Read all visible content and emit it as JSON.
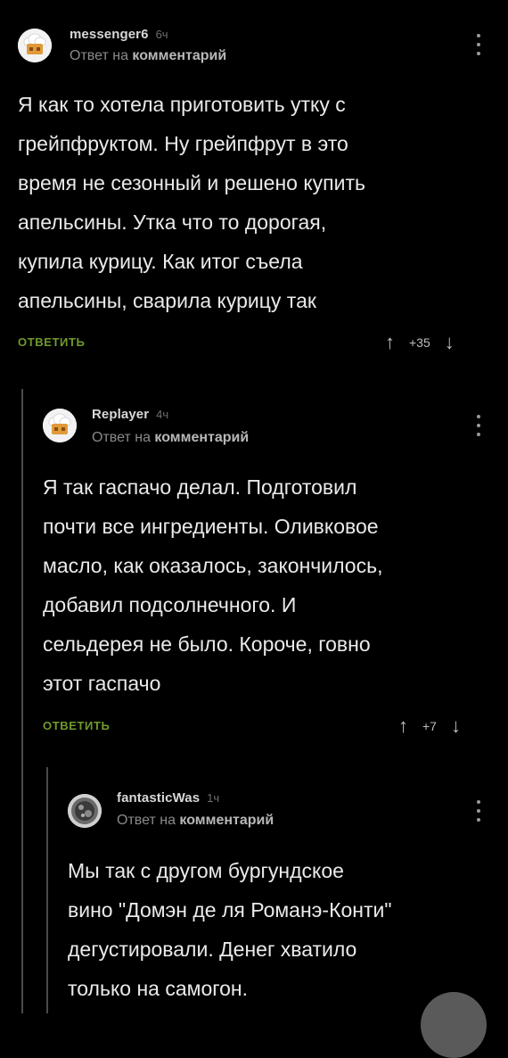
{
  "comments": [
    {
      "username": "messenger6",
      "time": "6ч",
      "reply_prefix": "Ответ на",
      "reply_target": "комментарий",
      "lines": [
        "Я как то хотела приготовить утку с",
        "грейпфруктом. Ну грейпфрут в это",
        "время не сезонный и решено купить",
        "апельсины. Утка что то дорогая,",
        "купила курицу. Как итог съела",
        "апельсины, сварила курицу так"
      ],
      "reply_label": "ОТВЕТИТЬ",
      "score": "+35",
      "avatar_icon": "chef-hat-avatar-icon"
    },
    {
      "username": "Replayer",
      "time": "4ч",
      "reply_prefix": "Ответ на",
      "reply_target": "комментарий",
      "lines": [
        "Я так гаспачо делал. Подготовил",
        "почти все ингредиенты. Оливковое",
        "масло, как оказалось, закончилось,",
        "добавил подсолнечного. И",
        "сельдерея не было. Короче, говно",
        "этот гаспачо"
      ],
      "reply_label": "ОТВЕТИТЬ",
      "score": "+7",
      "avatar_icon": "chef-hat-avatar-icon"
    },
    {
      "username": "fantasticWas",
      "time": "1ч",
      "reply_prefix": "Ответ на",
      "reply_target": "комментарий",
      "lines": [
        "Мы так с другом бургундское",
        "вино \"Домэн де ля Романэ-Конти\"",
        "дегустировали. Денег хватило",
        "только на самогон."
      ],
      "avatar_icon": "photo-avatar-icon"
    }
  ],
  "icons": {
    "up": "↑",
    "down": "↓"
  },
  "colors": {
    "background": "#000000",
    "reply_button": "#6f9a2c",
    "thread_line": "#4a4a4a"
  }
}
